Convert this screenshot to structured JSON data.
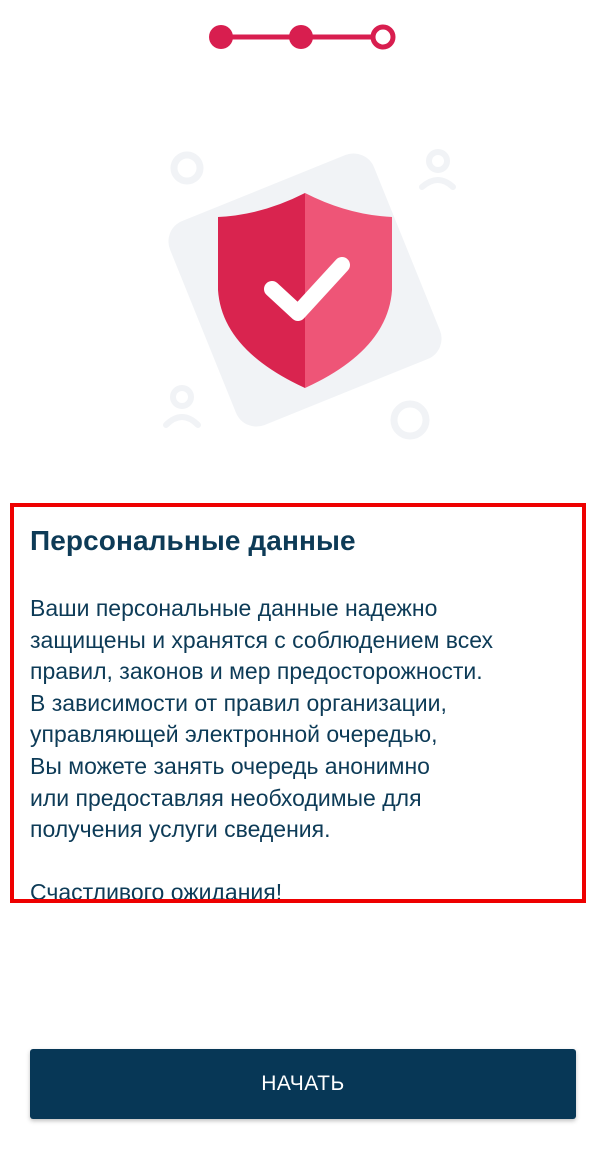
{
  "stepper": {
    "total_steps": 3,
    "current_step": 3,
    "accent_color": "#d81e4f"
  },
  "illustration": {
    "icon": "shield-check-icon",
    "shield_color_left": "#d9244f",
    "shield_color_right": "#ee5577",
    "background_color": "#f1f3f6"
  },
  "info": {
    "title": "Персональные данные",
    "lines": [
      "Ваши персональные данные надежно",
      "защищены и хранятся с соблюдением всех",
      "правил, законов и мер предосторожности.",
      "В зависимости от правил организации,",
      "управляющей электронной очередью,",
      "Вы можете занять очередь анонимно",
      "или предоставляя необходимые для",
      "получения услуги сведения."
    ],
    "closing": "Счастливого ожидания!",
    "highlight_color": "#ee0000"
  },
  "start_button": {
    "label": "НАЧАТЬ",
    "background": "#073756"
  }
}
